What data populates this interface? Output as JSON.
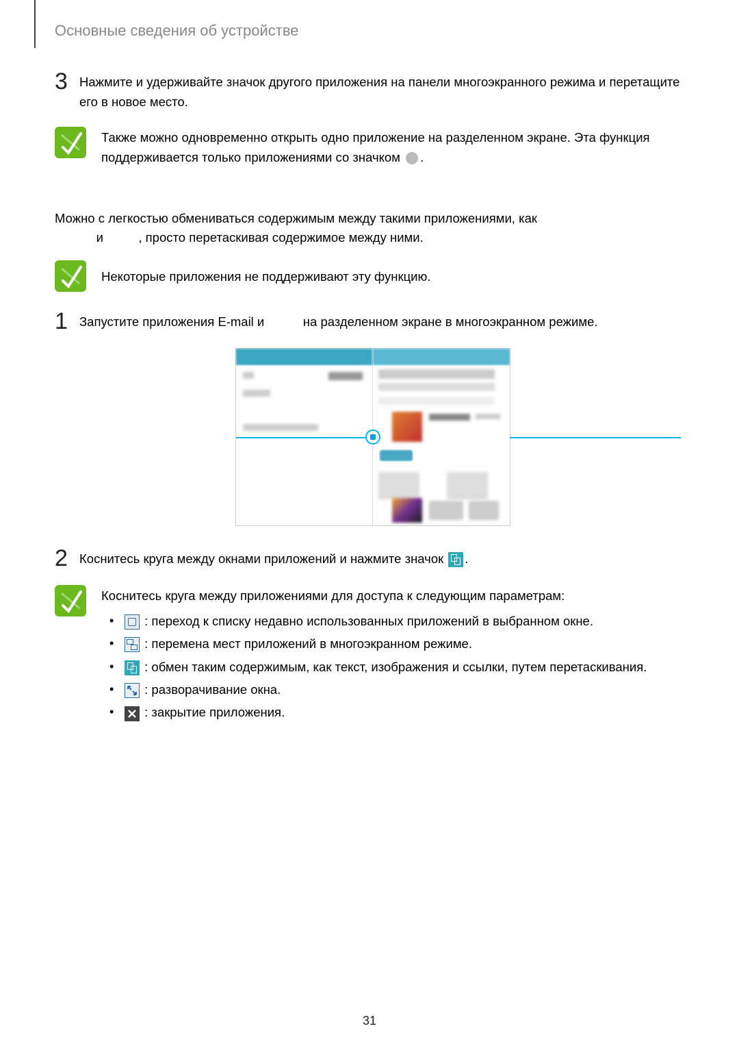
{
  "header": {
    "section_title": "Основные сведения об устройстве"
  },
  "step3": {
    "num": "3",
    "text": "Нажмите и удерживайте значок другого приложения на панели многоэкранного режима и перетащите его в новое место."
  },
  "note1": {
    "text_before": "Также можно одновременно открыть одно приложение на разделенном экране. Эта функция поддерживается только приложениями со значком ",
    "text_after": "."
  },
  "intro": {
    "line1": "Можно с легкостью обмениваться содержимым между такими приложениями, как",
    "line2_mid": " и ",
    "line2_after": ", просто перетаскивая содержимое между ними."
  },
  "note2": {
    "text": "Некоторые приложения не поддерживают эту функцию."
  },
  "step1": {
    "num": "1",
    "text_a": "Запустите приложения E-mail и ",
    "text_b": " на разделенном экране в многоэкранном режиме."
  },
  "step2": {
    "num": "2",
    "text_a": "Коснитесь круга между окнами приложений и нажмите значок ",
    "text_b": "."
  },
  "note3": {
    "intro": "Коснитесь круга между приложениями для доступа к следующим параметрам:",
    "items": [
      " : переход к списку недавно использованных приложений в выбранном окне.",
      " : перемена мест приложений в многоэкранном режиме.",
      " : обмен таким содержимым, как текст, изображения и ссылки, путем перетаскивания.",
      " : разворачивание окна.",
      " : закрытие приложения."
    ]
  },
  "page_number": "31"
}
